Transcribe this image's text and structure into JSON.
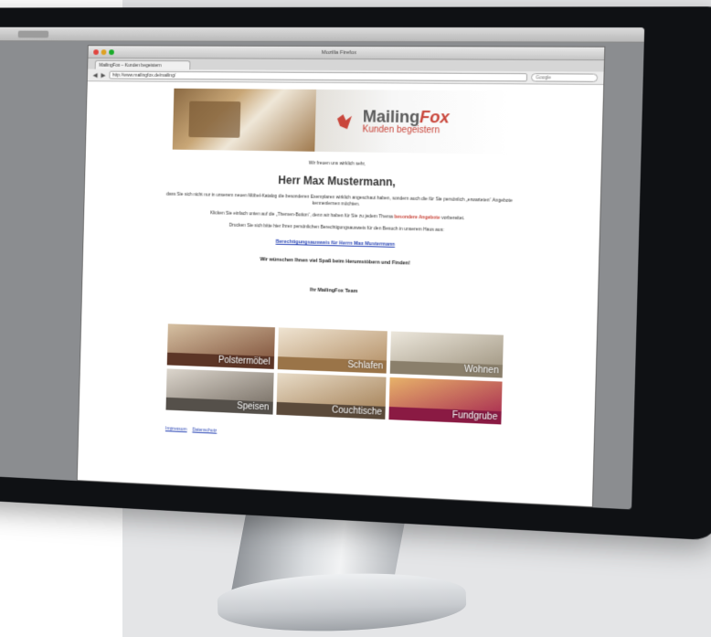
{
  "browser": {
    "window_title": "Mozilla Firefox",
    "tab_title": "MailingFox – Kunden begeistern",
    "url": "http://www.mailingfox.de/mailing/",
    "search_placeholder": "Google"
  },
  "email": {
    "logo": {
      "brand_part1": "Mailing",
      "brand_part2": "Fox",
      "tagline": "Kunden begeistern"
    },
    "intro": "Wir freuen uns wirklich sehr,",
    "greeting": "Herr Max Mustermann,",
    "paragraph1": "dass Sie sich nicht nur in unserem neuen Möbel-Katalog die besonderen Exemplaren wirklich angeschaut haben, sondern auch die für Sie persönlich „erwarteten“ Angebote kennenlernen möchten.",
    "paragraph2_text": "Klicken Sie einfach unten auf die „Themen-Button“, denn wir haben für Sie zu jedem Thema",
    "paragraph2_highlight": "besondere Angebote",
    "paragraph2_end": "vorbereitet.",
    "paragraph3": "Drucken Sie sich bitte hier Ihren persönlichen Berechtigungsausweis für den Besuch in unserem Haus aus:",
    "link": "Berechtigungsausweis für Herrn Max Mustermann",
    "wish": "Wir wünschen Ihnen viel Spaß beim Herumstöbern und Finden!",
    "signoff": "Ihr MailingFox Team",
    "categories": [
      {
        "label": "Polstermöbel",
        "color": "#7a4a33"
      },
      {
        "label": "Schlafen",
        "color": "#b08a5f"
      },
      {
        "label": "Wohnen",
        "color": "#9a8f7a"
      },
      {
        "label": "Speisen",
        "color": "#6f665c"
      },
      {
        "label": "Couchtische",
        "color": "#a07a4e"
      },
      {
        "label": "Fundgrube",
        "color": "#a31f4f"
      }
    ],
    "footer_links": [
      "Impressum",
      "Datenschutz"
    ]
  }
}
